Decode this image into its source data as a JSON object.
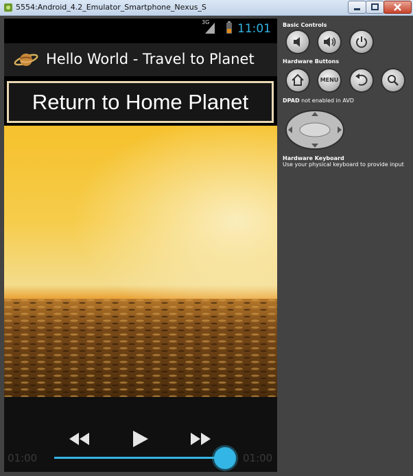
{
  "window": {
    "title": "5554:Android_4.2_Emulator_Smartphone_Nexus_S"
  },
  "statusbar": {
    "network": "3G",
    "time": "11:01"
  },
  "actionbar": {
    "title": "Hello World - Travel to Planet"
  },
  "main": {
    "return_button_label": "Return to Home Planet"
  },
  "media": {
    "current_time": "01:00",
    "total_time": "01:00",
    "progress": 1.0
  },
  "sidebar": {
    "basic_controls_label": "Basic Controls",
    "hardware_buttons_label": "Hardware Buttons",
    "menu_label": "MENU",
    "dpad_label_bold": "DPAD",
    "dpad_label_rest": "not enabled in AVD",
    "keyboard_label": "Hardware Keyboard",
    "keyboard_hint": "Use your physical keyboard to provide input"
  },
  "colors": {
    "accent": "#33b5e5",
    "emulator_bg": "#434343",
    "sky": "#f4c83a",
    "sea": "#5a3a14"
  }
}
